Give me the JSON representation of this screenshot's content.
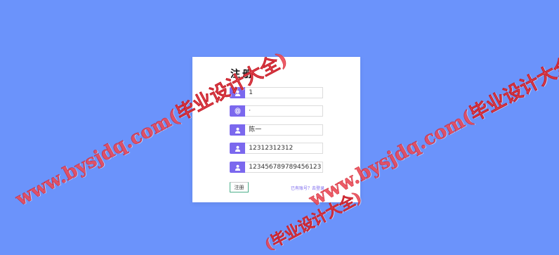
{
  "form": {
    "title": "注册",
    "fields": [
      {
        "icon": "user-icon",
        "value": "1"
      },
      {
        "icon": "fingerprint-icon",
        "value": "·"
      },
      {
        "icon": "user-icon",
        "value": "陈一"
      },
      {
        "icon": "user-icon",
        "value": "12312312312"
      },
      {
        "icon": "user-icon",
        "value": "123456789789456123"
      }
    ],
    "submit_label": "注册",
    "login_link": "已有账号？去登录"
  },
  "watermark": {
    "text_left": "www.bysjdq.com(毕业设计大全)",
    "text_right": "www.bysjdq.com(毕业设计大全)",
    "text_bottom": "(毕业设计大全)"
  },
  "colors": {
    "background": "#6b93fb",
    "icon_accent": "#7b68ee",
    "watermark": "#e83746"
  }
}
